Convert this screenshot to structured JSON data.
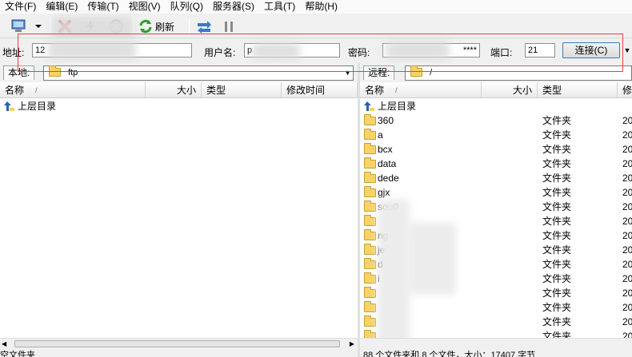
{
  "menu": [
    "文件(F)",
    "编辑(E)",
    "传输(T)",
    "视图(V)",
    "队列(Q)",
    "服务器(S)",
    "工具(T)",
    "帮助(H)"
  ],
  "toolbar": {
    "refresh_label": "刷新"
  },
  "connection": {
    "address_label": "地址:",
    "address_value": "12",
    "username_label": "用户名:",
    "username_value": "p",
    "password_label": "密码:",
    "password_value": "****",
    "port_label": "端口:",
    "port_value": "21",
    "connect_label": "连接(C)"
  },
  "local": {
    "tab_label": "本地:",
    "path": "ftp",
    "columns": {
      "name": "名称",
      "size": "大小",
      "type": "类型",
      "modified": "修改时间"
    },
    "rows": [
      {
        "name": "上层目录"
      }
    ],
    "status": "空文件夹"
  },
  "remote": {
    "tab_label": "远程:",
    "path": "/",
    "columns": {
      "name": "名称",
      "size": "大小",
      "type": "类型",
      "modified": "修"
    },
    "rows": [
      {
        "name": "上层目录",
        "type": "",
        "time": ""
      },
      {
        "name": "360",
        "type": "文件夹",
        "time": "20"
      },
      {
        "name": "a",
        "type": "文件夹",
        "time": "20"
      },
      {
        "name": "bcx",
        "type": "文件夹",
        "time": "20"
      },
      {
        "name": "data",
        "type": "文件夹",
        "time": "20"
      },
      {
        "name": "dede",
        "type": "文件夹",
        "time": "20"
      },
      {
        "name": "gjx",
        "type": "文件夹",
        "time": "20"
      },
      {
        "name": "sou0",
        "type": "文件夹",
        "time": "20"
      },
      {
        "name": "",
        "type": "文件夹",
        "time": "20"
      },
      {
        "name": "ng",
        "type": "文件夹",
        "time": "20"
      },
      {
        "name": "je",
        "type": "文件夹",
        "time": "20"
      },
      {
        "name": "d",
        "type": "文件夹",
        "time": "20"
      },
      {
        "name": "i",
        "type": "文件夹",
        "time": "20"
      },
      {
        "name": "",
        "type": "文件夹",
        "time": "20"
      },
      {
        "name": "",
        "type": "文件夹",
        "time": "20"
      },
      {
        "name": "",
        "type": "文件夹",
        "time": "20"
      },
      {
        "name": "",
        "type": "文件夹",
        "time": "20"
      }
    ],
    "status": "88 个文件夹和 8 个文件，大小：17407 字节"
  }
}
